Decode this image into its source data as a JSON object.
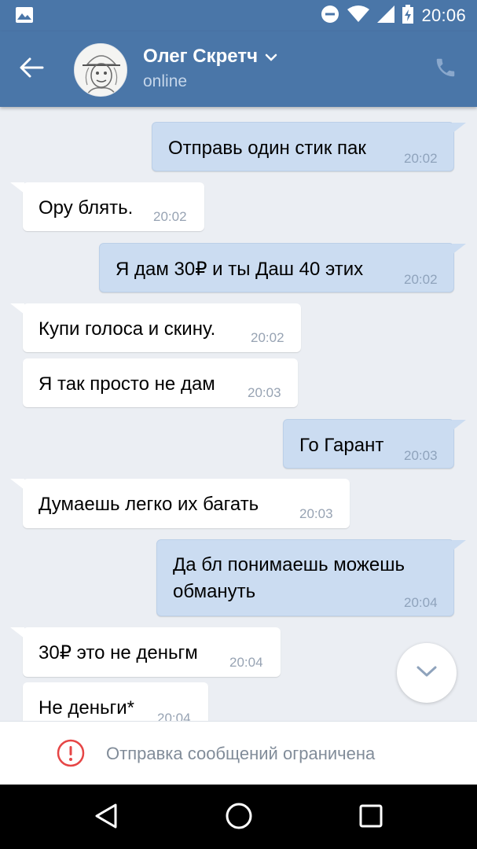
{
  "status_bar": {
    "time": "20:06",
    "icons": [
      "image-notification-icon",
      "do-not-disturb-icon",
      "wifi-icon",
      "signal-icon",
      "battery-charging-icon"
    ]
  },
  "header": {
    "contact_name": "Олег Скретч",
    "contact_status": "online",
    "icons": [
      "back-arrow-icon",
      "chevron-down-icon",
      "phone-icon"
    ]
  },
  "messages": [
    {
      "direction": "out",
      "text": "Отправь один стик пак",
      "time": "20:02"
    },
    {
      "direction": "in",
      "text": "Ору блять.",
      "time": "20:02"
    },
    {
      "direction": "out",
      "text": "Я дам 30₽ и ты Даш 40 этих",
      "time": "20:02"
    },
    {
      "direction": "in",
      "text": "Купи голоса и скину.",
      "time": "20:02"
    },
    {
      "direction": "in",
      "text": "Я так просто не дам",
      "time": "20:03"
    },
    {
      "direction": "out",
      "text": "Го Гарант",
      "time": "20:03"
    },
    {
      "direction": "in",
      "text": "Думаешь легко их багать",
      "time": "20:03"
    },
    {
      "direction": "out",
      "text_line1": "Да бл понимаешь можешь",
      "text_line2": "обмануть",
      "time": "20:04"
    },
    {
      "direction": "in",
      "text": "30₽ это не деньгм",
      "time": "20:04"
    },
    {
      "direction": "in",
      "text": "Не деньги*",
      "time": "20:04"
    }
  ],
  "composer": {
    "restriction_text": "Отправка сообщений ограничена",
    "icon": "warning-circle-icon"
  },
  "nav_bar": {
    "icons": [
      "back-triangle-icon",
      "home-circle-icon",
      "recents-square-icon"
    ]
  },
  "colors": {
    "accent": "#4a76a8",
    "chat_background": "#ebeef3",
    "outgoing_bubble": "#cbdcf1",
    "incoming_bubble": "#ffffff",
    "warning": "#e64646"
  }
}
